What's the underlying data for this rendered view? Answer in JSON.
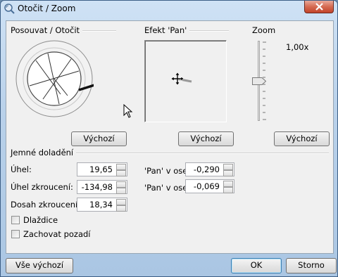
{
  "window": {
    "title": "Otočit / Zoom"
  },
  "groups": {
    "rotate": "Posouvat / Otočit",
    "pan": "Efekt 'Pan'",
    "zoom": "Zoom",
    "fine": "Jemné doladění"
  },
  "zoom_value": "1,00x",
  "zoom_slider_level": 0.5,
  "buttons": {
    "default1": "Výchozí",
    "default2": "Výchozí",
    "default3": "Výchozí",
    "all_default": "Vše výchozí",
    "ok": "OK",
    "cancel": "Storno"
  },
  "fields": {
    "angle": {
      "label": "Úhel:",
      "value": "19,65"
    },
    "skew_angle": {
      "label": "Úhel zkroucení:",
      "value": "-134,98"
    },
    "skew_reach": {
      "label": "Dosah zkroucení:",
      "value": "18,34"
    },
    "pan_x": {
      "label": "'Pan' v ose X",
      "value": "-0,290"
    },
    "pan_y": {
      "label": "'Pan' v ose Y",
      "value": "-0,069"
    }
  },
  "checkboxes": {
    "tile": {
      "label": "Dlaždice",
      "checked": false
    },
    "keep_bg": {
      "label": "Zachovat pozadí",
      "checked": false
    }
  }
}
